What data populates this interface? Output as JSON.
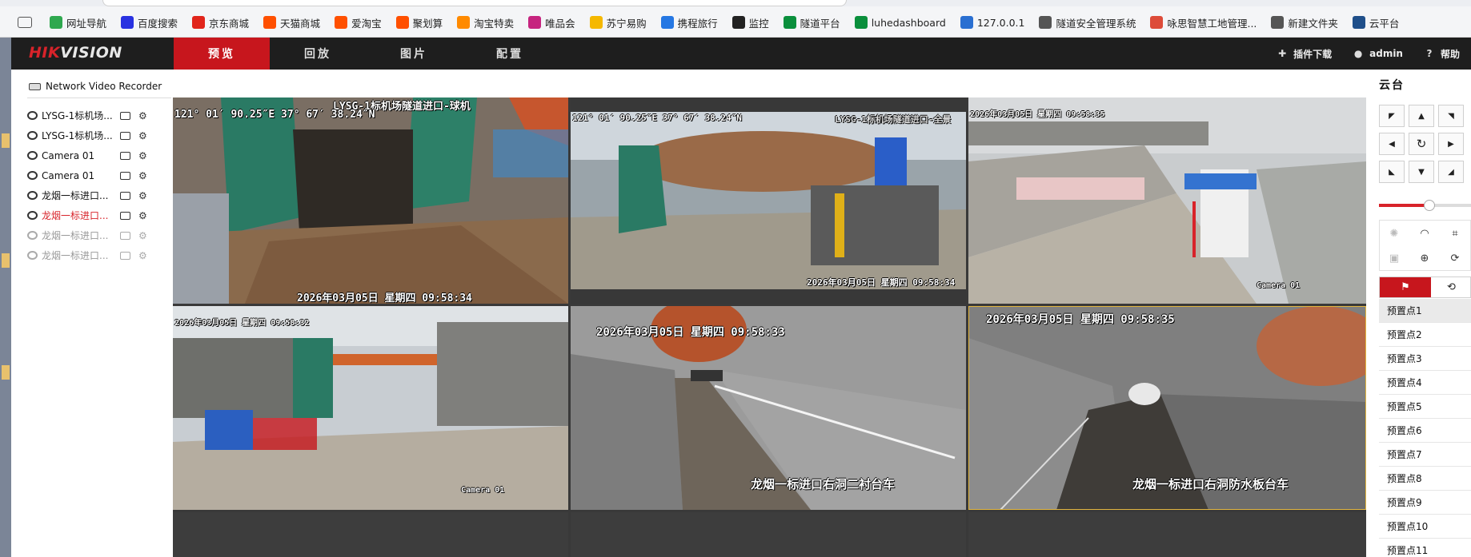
{
  "browser": {
    "bookmarks": [
      {
        "label": "网址导航",
        "icon": "hao-icon",
        "color": "#2fa84f"
      },
      {
        "label": "百度搜索",
        "icon": "baidu-icon",
        "color": "#2932e1"
      },
      {
        "label": "京东商城",
        "icon": "jd-icon",
        "color": "#e1251b"
      },
      {
        "label": "天猫商城",
        "icon": "tmall-icon",
        "color": "#ff5000"
      },
      {
        "label": "爱淘宝",
        "icon": "aitaobao-icon",
        "color": "#ff5000"
      },
      {
        "label": "聚划算",
        "icon": "juhuasuan-icon",
        "color": "#ff5000"
      },
      {
        "label": "淘宝特卖",
        "icon": "taobao-icon",
        "color": "#ff8a00"
      },
      {
        "label": "唯品会",
        "icon": "vip-icon",
        "color": "#c6247f"
      },
      {
        "label": "苏宁易购",
        "icon": "suning-icon",
        "color": "#f5b800"
      },
      {
        "label": "携程旅行",
        "icon": "ctrip-icon",
        "color": "#2577e3"
      },
      {
        "label": "监控",
        "icon": "monitor-icon",
        "color": "#222222"
      },
      {
        "label": "隧道平台",
        "icon": "tunnel-platform-icon",
        "color": "#0a8f3c"
      },
      {
        "label": "luhedashboard",
        "icon": "dashboard-icon",
        "color": "#0a8f3c"
      },
      {
        "label": "127.0.0.1",
        "icon": "localhost-icon",
        "color": "#2a6fd1"
      },
      {
        "label": "隧道安全管理系统",
        "icon": "safety-system-icon",
        "color": "#555555"
      },
      {
        "label": "咏思智慧工地管理...",
        "icon": "chrome-icon",
        "color": "#dd4b39"
      },
      {
        "label": "新建文件夹",
        "icon": "folder-icon",
        "color": "#555555"
      },
      {
        "label": "云平台",
        "icon": "cloud-platform-icon",
        "color": "#1f4f8a"
      }
    ]
  },
  "header": {
    "logo_left": "HIK",
    "logo_right": "VISION",
    "nav": [
      {
        "label": "预览",
        "active": true
      },
      {
        "label": "回放",
        "active": false
      },
      {
        "label": "图片",
        "active": false
      },
      {
        "label": "配置",
        "active": false
      }
    ],
    "plugin_download": "插件下载",
    "user": "admin",
    "help": "帮助",
    "accent": "#c7161d"
  },
  "tree": {
    "title": "Network Video Recorder",
    "channels": [
      {
        "label": "LYSG-1标机场...",
        "state": "normal"
      },
      {
        "label": "LYSG-1标机场...",
        "state": "normal"
      },
      {
        "label": "Camera 01",
        "state": "normal"
      },
      {
        "label": "Camera 01",
        "state": "normal"
      },
      {
        "label": "龙烟一标进口...",
        "state": "normal"
      },
      {
        "label": "龙烟一标进口...",
        "state": "selected"
      },
      {
        "label": "龙烟一标进口...",
        "state": "offline"
      },
      {
        "label": "龙烟一标进口...",
        "state": "offline"
      }
    ]
  },
  "videos": [
    {
      "top_text": "LYSG-1标机场隧道进口-球机",
      "coords": "121° 01′ 90.25″E 37° 67′ 38.24″N",
      "timestamp": "2026年03月05日  星期四  09:58:34",
      "name": ""
    },
    {
      "top_text": "LYSG-1标机场隧道进口-全景",
      "coords": "121° 01′ 90.25″E 37° 67′ 38.24″N",
      "timestamp": "2026年03月05日  星期四  09:58:34",
      "name": ""
    },
    {
      "top_text": "",
      "coords": "",
      "timestamp": "2026年03月05日  星期四  09:58:35",
      "name": "Camera 01"
    },
    {
      "top_text": "",
      "coords": "",
      "timestamp": "2026年03月05日  星期四  09:58:32",
      "name": "Camera 01"
    },
    {
      "top_text": "",
      "coords": "",
      "timestamp": "2026年03月05日  星期四  09:58:33",
      "name": "龙烟一标进口右洞二衬台车"
    },
    {
      "top_text": "",
      "coords": "",
      "timestamp": "2026年03月05日  星期四  09:58:35",
      "name": "龙烟一标进口右洞防水板台车"
    }
  ],
  "ptz": {
    "title": "云台",
    "speed_fraction": 0.55,
    "presets": [
      "预置点1",
      "预置点2",
      "预置点3",
      "预置点4",
      "预置点5",
      "预置点6",
      "预置点7",
      "预置点8",
      "预置点9",
      "预置点10",
      "预置点11"
    ]
  }
}
